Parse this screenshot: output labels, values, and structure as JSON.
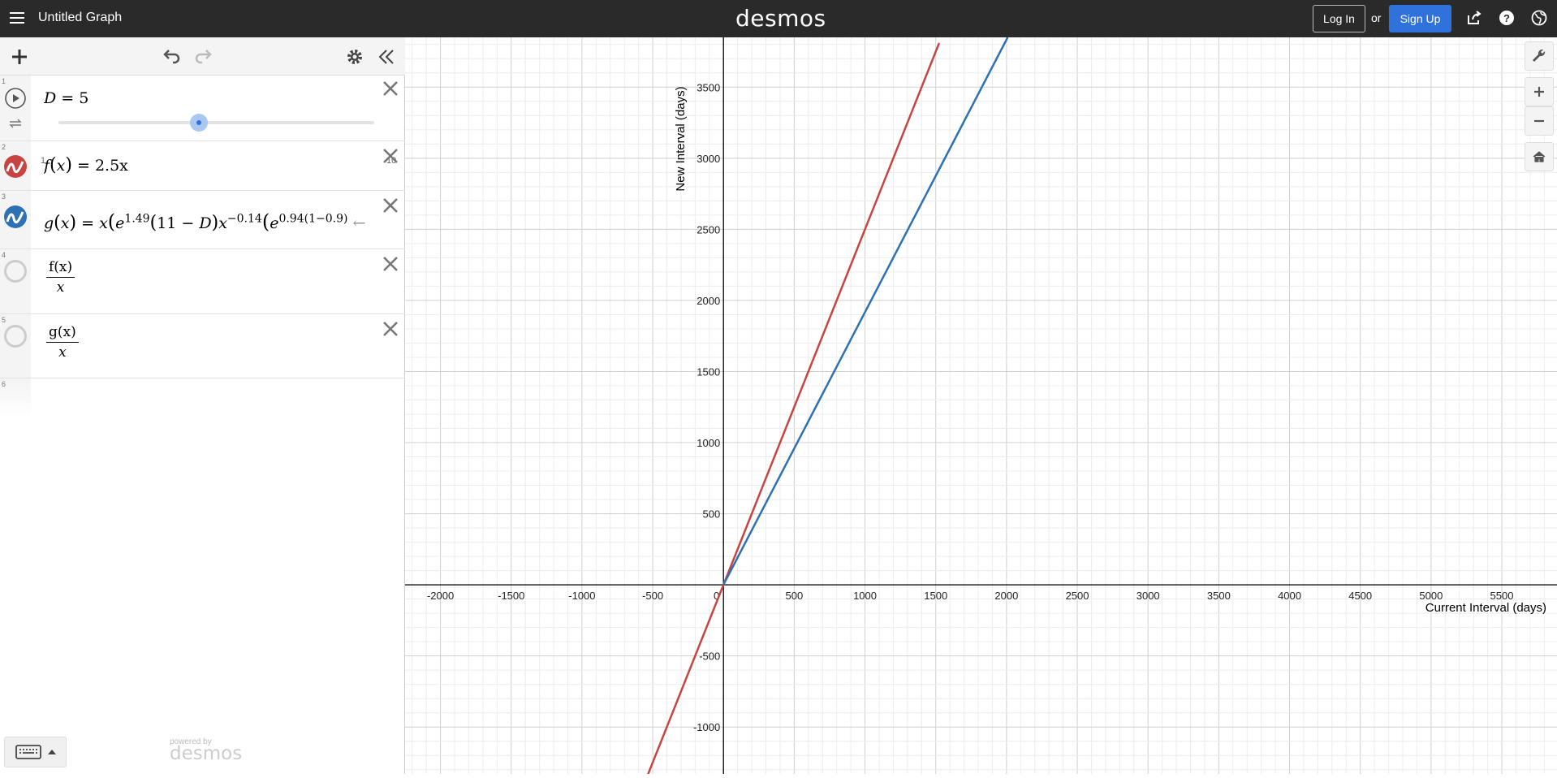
{
  "header": {
    "graph_title": "Untitled Graph",
    "logo_text": "desmos",
    "login_label": "Log In",
    "or_text": "or",
    "signup_label": "Sign Up"
  },
  "expressions": [
    {
      "num": "1",
      "lhs": "D",
      "rhs": "= 5",
      "slider": {
        "min": "1",
        "max": "10",
        "value": 5
      }
    },
    {
      "num": "2",
      "text": "= 2.5x",
      "color": "#c74440"
    },
    {
      "num": "3",
      "lhs": "g",
      "color": "#2d70b3"
    },
    {
      "num": "4",
      "numerator": "f(x)",
      "denominator": "x"
    },
    {
      "num": "5",
      "numerator": "g(x)",
      "denominator": "x"
    },
    {
      "num": "6"
    }
  ],
  "footer": {
    "powered_by": "powered by",
    "powered_logo": "desmos"
  },
  "graph": {
    "x_axis_label": "Current Interval (days)",
    "y_axis_label": "New Interval (days)",
    "x_ticks": [
      "-2000",
      "-1500",
      "-1000",
      "-500",
      "0",
      "500",
      "1000",
      "1500",
      "2000",
      "2500",
      "3000",
      "3500",
      "4000",
      "4500",
      "5000",
      "5500"
    ],
    "y_ticks": [
      "3500",
      "3000",
      "2500",
      "2000",
      "1500",
      "1000",
      "500",
      "-500",
      "-1000"
    ]
  },
  "chart_data": {
    "type": "line",
    "title": "",
    "xlabel": "Current Interval (days)",
    "ylabel": "New Interval (days)",
    "xlim": [
      -2250,
      5890
    ],
    "ylim": [
      -1330,
      3850
    ],
    "grid": true,
    "series": [
      {
        "name": "f(x) = 2.5x",
        "color": "#c74440",
        "x": [
          -537,
          1524
        ],
        "y": [
          -1342,
          3810
        ]
      },
      {
        "name": "g(x)",
        "color": "#2d70b3",
        "x": [
          0,
          2008
        ],
        "y": [
          0,
          3850
        ]
      }
    ]
  }
}
